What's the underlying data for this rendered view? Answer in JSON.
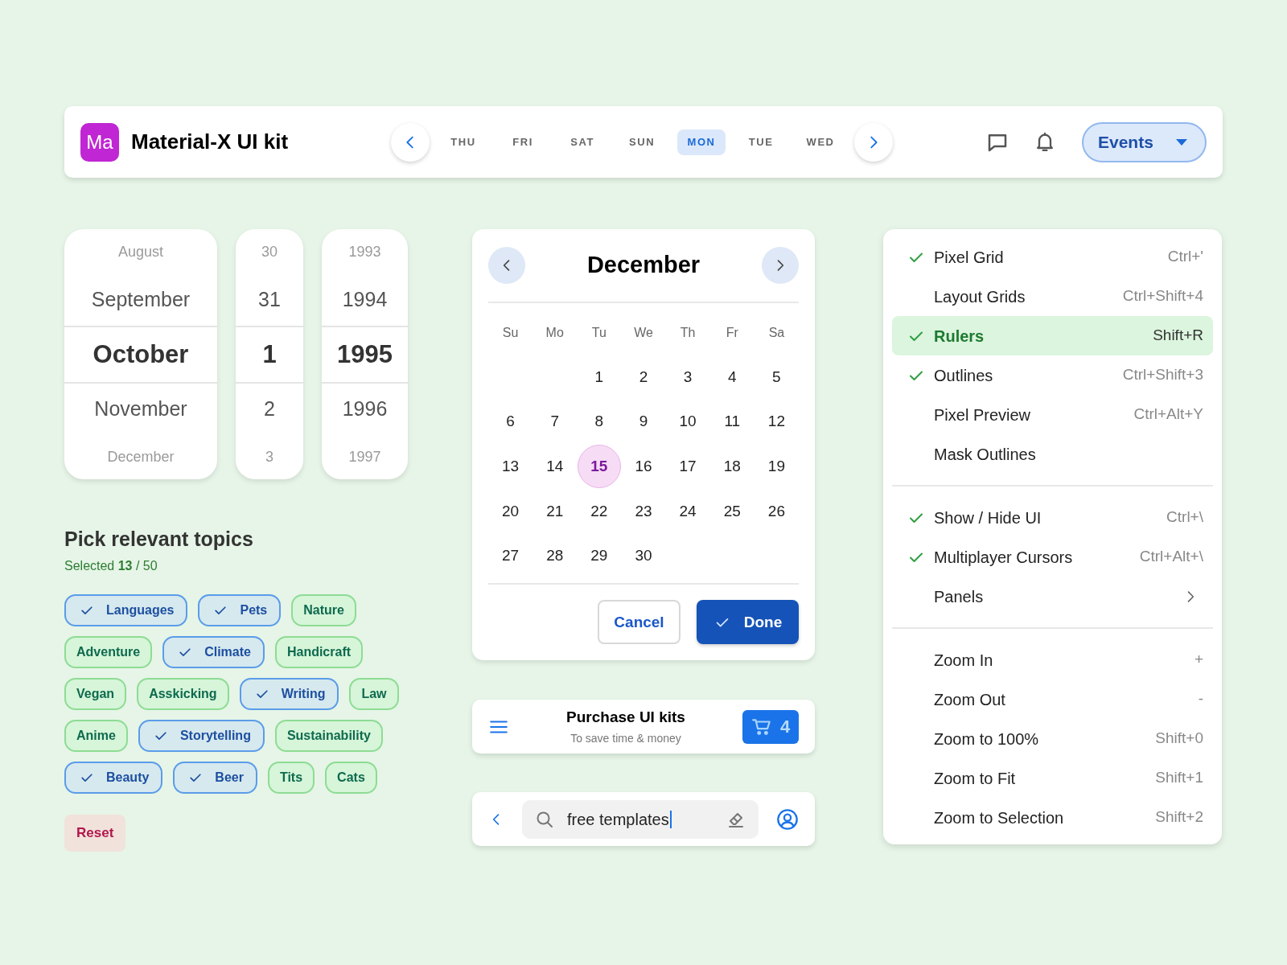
{
  "header": {
    "logo": "Ma",
    "title": "Material-X UI kit",
    "days": [
      {
        "label": "THU",
        "selected": false
      },
      {
        "label": "FRI",
        "selected": false
      },
      {
        "label": "SAT",
        "selected": false
      },
      {
        "label": "SUN",
        "selected": false
      },
      {
        "label": "MON",
        "selected": true
      },
      {
        "label": "TUE",
        "selected": false
      },
      {
        "label": "WED",
        "selected": false
      }
    ],
    "events_button": "Events"
  },
  "date_picker": [
    {
      "items": [
        {
          "text": "August",
          "selected": false
        },
        {
          "text": "September",
          "selected": false
        },
        {
          "text": "October",
          "selected": true
        },
        {
          "text": "November",
          "selected": false
        },
        {
          "text": "December",
          "selected": false
        }
      ]
    },
    {
      "items": [
        {
          "text": "30",
          "selected": false
        },
        {
          "text": "31",
          "selected": false
        },
        {
          "text": "1",
          "selected": true
        },
        {
          "text": "2",
          "selected": false
        },
        {
          "text": "3",
          "selected": false
        }
      ]
    },
    {
      "items": [
        {
          "text": "1993",
          "selected": false
        },
        {
          "text": "1994",
          "selected": false
        },
        {
          "text": "1995",
          "selected": true
        },
        {
          "text": "1996",
          "selected": false
        },
        {
          "text": "1997",
          "selected": false
        }
      ]
    }
  ],
  "topics": {
    "title": "Pick relevant topics",
    "summary": "Selected **13** / 50",
    "chips": [
      {
        "label": "Languages",
        "selected": true
      },
      {
        "label": "Pets",
        "selected": true
      },
      {
        "label": "Nature",
        "selected": false
      },
      {
        "label": "Adventure",
        "selected": false
      },
      {
        "label": "Climate",
        "selected": true
      },
      {
        "label": "Handicraft",
        "selected": false
      },
      {
        "label": "Vegan",
        "selected": false
      },
      {
        "label": "Asskicking",
        "selected": false
      },
      {
        "label": "Writing",
        "selected": true
      },
      {
        "label": "Law",
        "selected": false
      },
      {
        "label": "Anime",
        "selected": false
      },
      {
        "label": "Storytelling",
        "selected": true
      },
      {
        "label": "Sustainability",
        "selected": false
      },
      {
        "label": "Beauty",
        "selected": true
      },
      {
        "label": "Beer",
        "selected": true
      },
      {
        "label": "Tits",
        "selected": false
      },
      {
        "label": "Cats",
        "selected": false
      }
    ],
    "reset_button": "Reset"
  },
  "calendar": {
    "month": "December",
    "weekdays": [
      "Su",
      "Mo",
      "Tu",
      "We",
      "Th",
      "Fr",
      "Sa"
    ],
    "days": [
      {
        "kind": "blank"
      },
      {
        "kind": "blank"
      },
      {
        "kind": "day",
        "label": "1",
        "selected": false
      },
      {
        "kind": "day",
        "label": "2",
        "selected": false
      },
      {
        "kind": "day",
        "label": "3",
        "selected": false
      },
      {
        "kind": "day",
        "label": "4",
        "selected": false
      },
      {
        "kind": "day",
        "label": "5",
        "selected": false
      },
      {
        "kind": "day",
        "label": "6",
        "selected": false
      },
      {
        "kind": "day",
        "label": "7",
        "selected": false
      },
      {
        "kind": "day",
        "label": "8",
        "selected": false
      },
      {
        "kind": "day",
        "label": "9",
        "selected": false
      },
      {
        "kind": "day",
        "label": "10",
        "selected": false
      },
      {
        "kind": "day",
        "label": "11",
        "selected": false
      },
      {
        "kind": "day",
        "label": "12",
        "selected": false
      },
      {
        "kind": "day",
        "label": "13",
        "selected": false
      },
      {
        "kind": "day",
        "label": "14",
        "selected": false
      },
      {
        "kind": "day",
        "label": "15",
        "selected": true
      },
      {
        "kind": "day",
        "label": "16",
        "selected": false
      },
      {
        "kind": "day",
        "label": "17",
        "selected": false
      },
      {
        "kind": "day",
        "label": "18",
        "selected": false
      },
      {
        "kind": "day",
        "label": "19",
        "selected": false
      },
      {
        "kind": "day",
        "label": "20",
        "selected": false
      },
      {
        "kind": "day",
        "label": "21",
        "selected": false
      },
      {
        "kind": "day",
        "label": "22",
        "selected": false
      },
      {
        "kind": "day",
        "label": "23",
        "selected": false
      },
      {
        "kind": "day",
        "label": "24",
        "selected": false
      },
      {
        "kind": "day",
        "label": "25",
        "selected": false
      },
      {
        "kind": "day",
        "label": "26",
        "selected": false
      },
      {
        "kind": "day",
        "label": "27",
        "selected": false
      },
      {
        "kind": "day",
        "label": "28",
        "selected": false
      },
      {
        "kind": "day",
        "label": "29",
        "selected": false
      },
      {
        "kind": "day",
        "label": "30",
        "selected": false
      }
    ],
    "cancel_button": "Cancel",
    "done_button": "Done"
  },
  "purchase_bar": {
    "title": "Purchase UI kits",
    "subtitle": "To save time & money",
    "cart_count": "4"
  },
  "search_bar": {
    "value": "free templates"
  },
  "menu": {
    "groups": [
      {
        "items": [
          {
            "kind": "item",
            "label": "Pixel Grid",
            "shortcut": "Ctrl+'",
            "checked": true,
            "selected": false
          },
          {
            "kind": "item",
            "label": "Layout Grids",
            "shortcut": "Ctrl+Shift+4",
            "checked": false,
            "selected": false
          },
          {
            "kind": "item",
            "label": "Rulers",
            "shortcut": "Shift+R",
            "checked": true,
            "selected": true
          },
          {
            "kind": "item",
            "label": "Outlines",
            "shortcut": "Ctrl+Shift+3",
            "checked": true,
            "selected": false
          },
          {
            "kind": "item",
            "label": "Pixel Preview",
            "shortcut": "Ctrl+Alt+Y",
            "checked": false,
            "selected": false
          },
          {
            "kind": "item",
            "label": "Mask Outlines",
            "checked": false,
            "selected": false
          }
        ]
      },
      {
        "items": [
          {
            "kind": "item",
            "label": "Show / Hide UI",
            "shortcut": "Ctrl+\\",
            "checked": true,
            "selected": false
          },
          {
            "kind": "item",
            "label": "Multiplayer Cursors",
            "shortcut": "Ctrl+Alt+\\",
            "checked": true,
            "selected": false
          },
          {
            "kind": "submenu",
            "label": "Panels",
            "checked": false,
            "selected": false
          }
        ]
      },
      {
        "items": [
          {
            "kind": "item",
            "label": "Zoom In",
            "shortcut": "+",
            "checked": false,
            "selected": false
          },
          {
            "kind": "item",
            "label": "Zoom Out",
            "shortcut": "-",
            "checked": false,
            "selected": false
          },
          {
            "kind": "item",
            "label": "Zoom to 100%",
            "shortcut": "Shift+0",
            "checked": false,
            "selected": false
          },
          {
            "kind": "item",
            "label": "Zoom to Fit",
            "shortcut": "Shift+1",
            "checked": false,
            "selected": false
          },
          {
            "kind": "item",
            "label": "Zoom to Selection",
            "shortcut": "Shift+2",
            "checked": false,
            "selected": false
          }
        ]
      }
    ]
  }
}
